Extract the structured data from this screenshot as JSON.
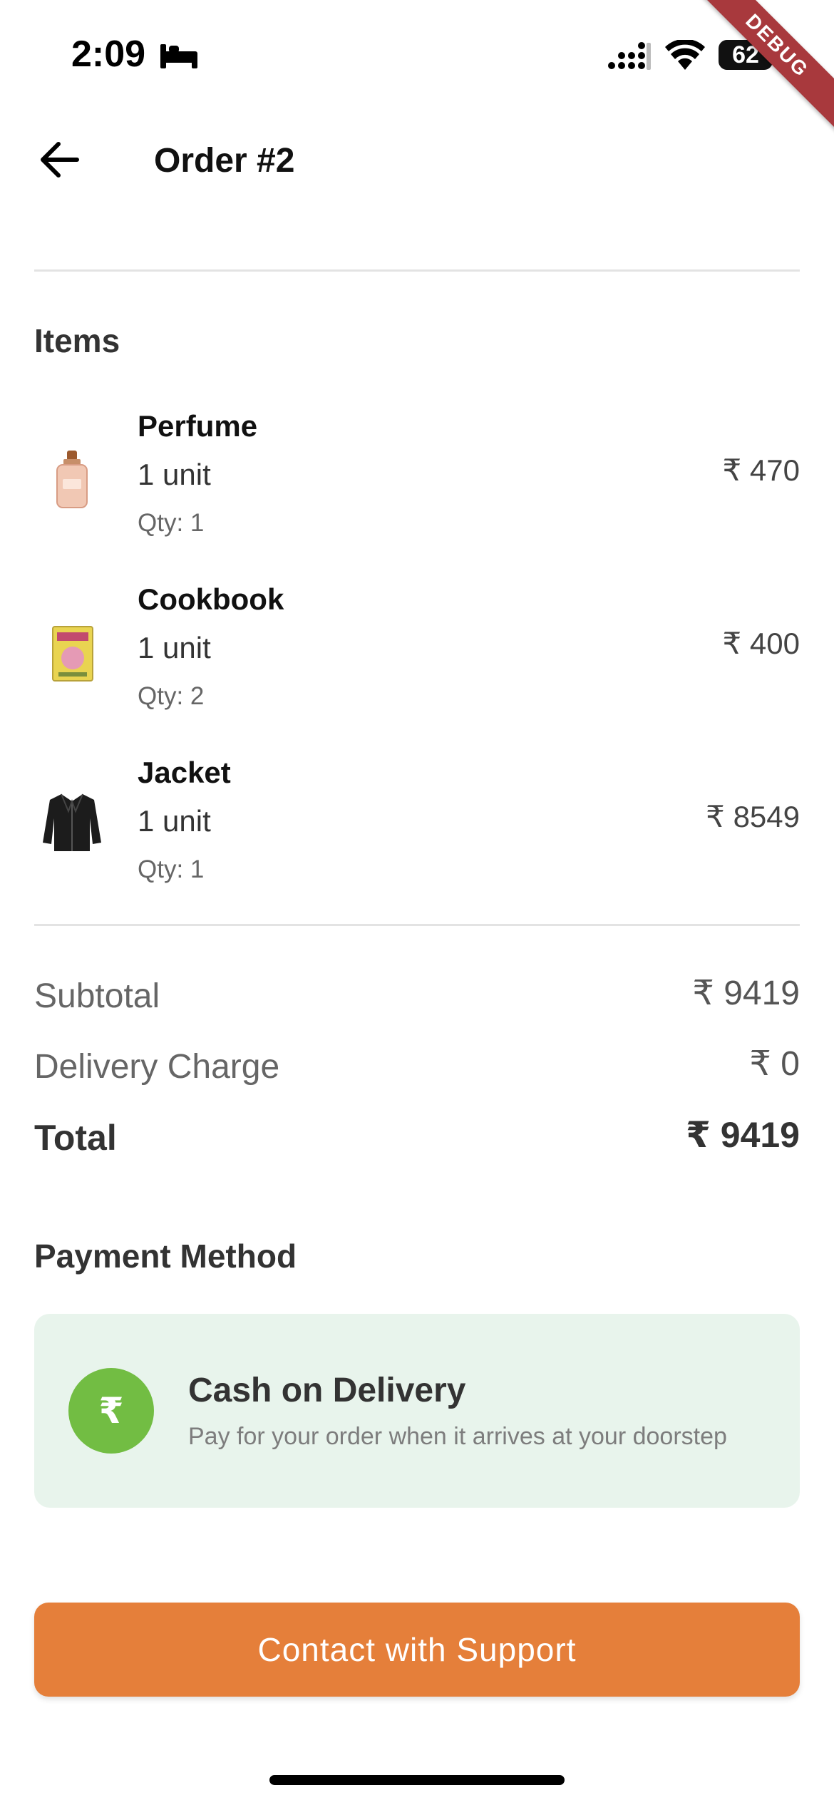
{
  "status_bar": {
    "time": "2:09",
    "battery": "62",
    "debug_label": "DEBUG"
  },
  "header": {
    "title": "Order #2"
  },
  "items_section": {
    "title": "Items",
    "items": [
      {
        "name": "Perfume",
        "unit": "1 unit",
        "qty": "Qty: 1",
        "price": "₹ 470",
        "icon": "perfume-bottle"
      },
      {
        "name": "Cookbook",
        "unit": "1 unit",
        "qty": "Qty: 2",
        "price": "₹ 400",
        "icon": "book"
      },
      {
        "name": "Jacket",
        "unit": "1 unit",
        "qty": "Qty: 1",
        "price": "₹ 8549",
        "icon": "leather-jacket"
      }
    ]
  },
  "summary": {
    "subtotal_label": "Subtotal",
    "subtotal_value": "₹ 9419",
    "delivery_label": "Delivery Charge",
    "delivery_value": "₹ 0",
    "total_label": "Total",
    "total_value": "₹ 9419"
  },
  "payment": {
    "section_title": "Payment Method",
    "icon_glyph": "₹",
    "method_title": "Cash on Delivery",
    "method_desc": "Pay for your order when it arrives at your doorstep"
  },
  "actions": {
    "support_label": "Contact with Support"
  },
  "colors": {
    "accent": "#e57f3a",
    "payment_bg": "#e8f4ec",
    "payment_icon": "#72bd43"
  }
}
